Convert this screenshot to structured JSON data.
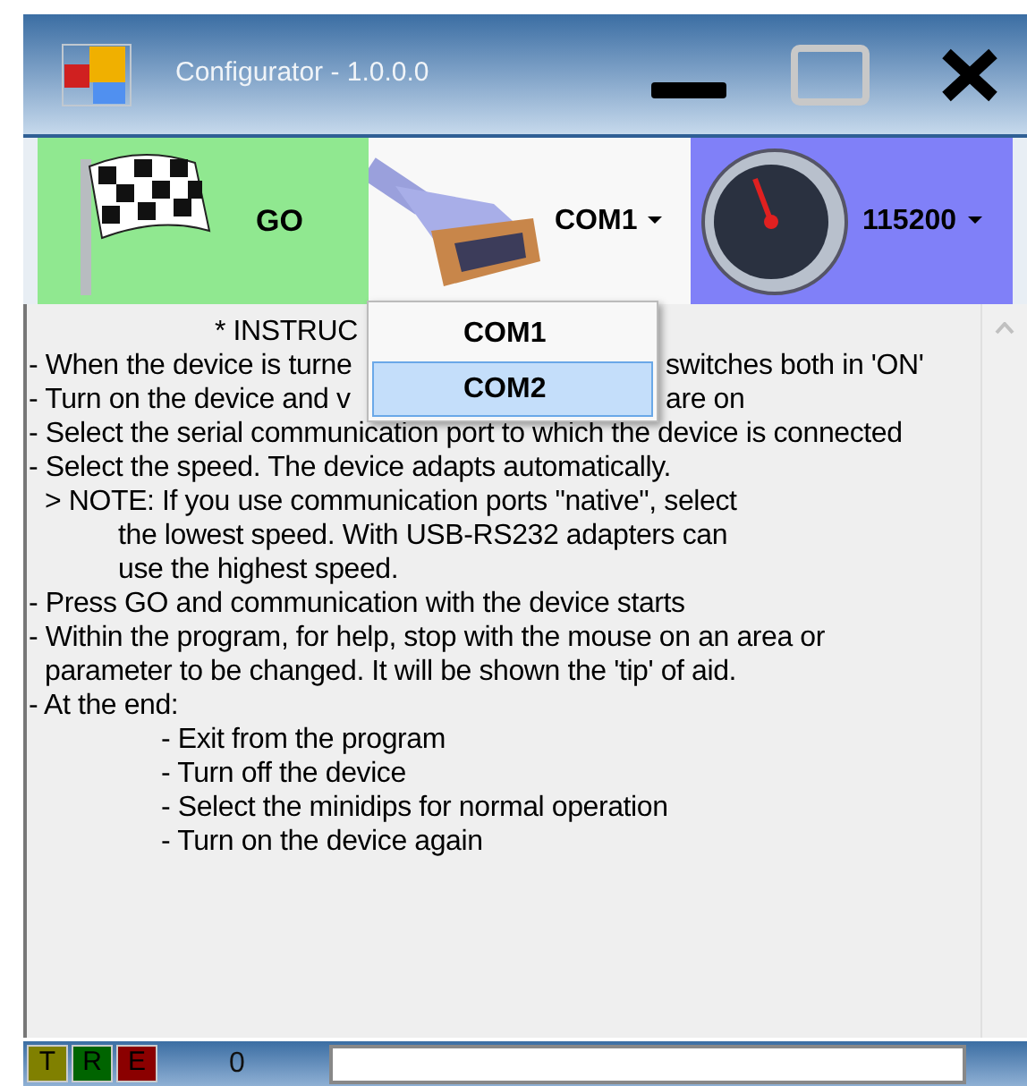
{
  "window": {
    "title": "Configurator - 1.0.0.0"
  },
  "toolbar": {
    "go_button": {
      "label": "GO"
    },
    "port_dropdown": {
      "value": "COM1",
      "expanded": true
    },
    "speed_dropdown": {
      "value": "115200"
    }
  },
  "port_menu": [
    {
      "label": "COM1",
      "selected": false
    },
    {
      "label": "COM2",
      "selected": true
    }
  ],
  "instructions": [
    {
      "kind": "title",
      "segments": [
        "* INSTRUC"
      ]
    },
    {
      "kind": "item",
      "segments": [
        "- When the device is turne",
        "switches both in 'ON'"
      ]
    },
    {
      "kind": "item",
      "segments": [
        "- Turn on the device and v",
        "are on"
      ]
    },
    {
      "kind": "item",
      "segments": [
        "- Select the serial communication port to which the device is connected"
      ]
    },
    {
      "kind": "item",
      "segments": [
        "- Select the speed. The device adapts automatically."
      ]
    },
    {
      "kind": "note",
      "segments": [
        "> NOTE: If you use communication ports \"native\", select"
      ]
    },
    {
      "kind": "note_cont",
      "segments": [
        "the lowest speed. With USB-RS232 adapters can"
      ]
    },
    {
      "kind": "note_cont",
      "segments": [
        "use the highest speed."
      ]
    },
    {
      "kind": "item",
      "segments": [
        "- Press GO and communication with the device starts"
      ]
    },
    {
      "kind": "item",
      "segments": [
        "- Within the program, for help, stop with the mouse on an area or"
      ]
    },
    {
      "kind": "cont",
      "segments": [
        "parameter to be changed. It will be shown the 'tip' of aid."
      ]
    },
    {
      "kind": "item",
      "segments": [
        "- At the end:"
      ]
    },
    {
      "kind": "sub",
      "segments": [
        "- Exit from the program"
      ]
    },
    {
      "kind": "sub",
      "segments": [
        "- Turn off the device"
      ]
    },
    {
      "kind": "sub",
      "segments": [
        "- Select the minidips for normal operation"
      ]
    },
    {
      "kind": "sub",
      "segments": [
        "- Turn on the device again"
      ]
    }
  ],
  "status_bar": {
    "indicators": [
      {
        "label": "T",
        "color": "#808000"
      },
      {
        "label": "R",
        "color": "#006400"
      },
      {
        "label": "E",
        "color": "#8b0000"
      }
    ],
    "counter": "0"
  }
}
